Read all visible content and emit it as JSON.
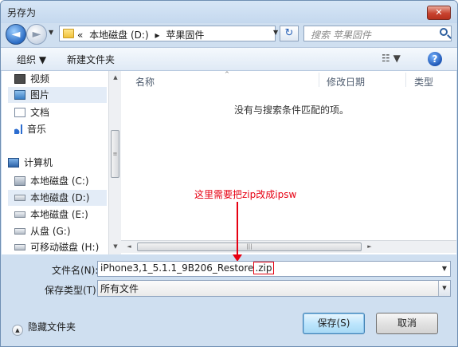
{
  "title": "另存为",
  "close_label": "✕",
  "nav": {
    "back": "◄",
    "forward": "►",
    "dropdown": "▼",
    "crumbs": [
      "«",
      "本地磁盘 (D:)",
      "▸",
      "苹果固件"
    ],
    "refresh": "↻",
    "search_placeholder": "搜索 苹果固件"
  },
  "toolbar": {
    "organize": "组织 ▼",
    "new_folder": "新建文件夹",
    "view": "☷ ▼",
    "help": "?"
  },
  "sidebar": {
    "items": [
      {
        "label": "视频",
        "icon": "video-icon"
      },
      {
        "label": "图片",
        "icon": "picture-icon",
        "selected": true
      },
      {
        "label": "文档",
        "icon": "document-icon"
      },
      {
        "label": "音乐",
        "icon": "music-icon"
      },
      {
        "label": "计算机",
        "icon": "computer-icon"
      },
      {
        "label": "本地磁盘 (C:)",
        "icon": "system-drive-icon"
      },
      {
        "label": "本地磁盘 (D:)",
        "icon": "drive-icon",
        "selected": true
      },
      {
        "label": "本地磁盘 (E:)",
        "icon": "drive-icon"
      },
      {
        "label": "从盘 (G:)",
        "icon": "drive-icon"
      },
      {
        "label": "可移动磁盘 (H:)",
        "icon": "removable-drive-icon"
      }
    ]
  },
  "columns": {
    "name": "名称",
    "modified": "修改日期",
    "type": "类型",
    "sort": "^"
  },
  "empty_message": "没有与搜索条件匹配的项。",
  "annotation": "这里需要把zip改成ipsw",
  "filename": {
    "label": "文件名(N):",
    "value_prefix": "iPhone3,1_5.1.1_9B206_Restore",
    "value_ext": ".zip"
  },
  "filetype": {
    "label": "保存类型(T):",
    "value": "所有文件"
  },
  "hide_folders": "隐藏文件夹",
  "save_button": "保存(S)",
  "cancel_button": "取消",
  "scroll_grip": "≡",
  "hscroll_grip": "|||"
}
